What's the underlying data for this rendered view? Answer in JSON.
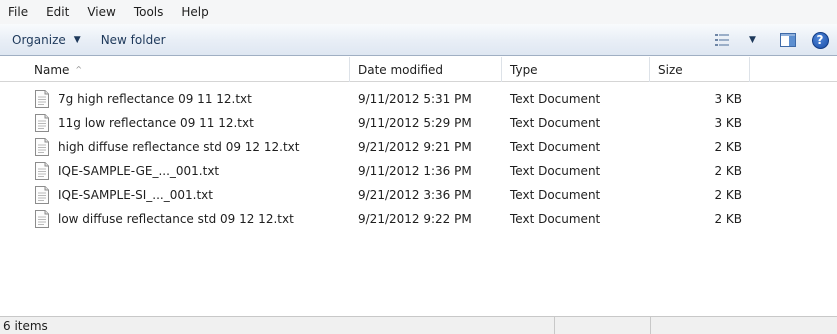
{
  "menu": [
    "File",
    "Edit",
    "View",
    "Tools",
    "Help"
  ],
  "toolbar": {
    "organize_label": "Organize",
    "new_folder_label": "New folder",
    "caret": "▼",
    "help_glyph": "?"
  },
  "columns": {
    "name": "Name",
    "date": "Date modified",
    "type": "Type",
    "size": "Size",
    "sort_glyph": "^"
  },
  "files": [
    {
      "name": "7g high reflectance 09 11 12.txt",
      "date": "9/11/2012 5:31 PM",
      "type": "Text Document",
      "size": "3 KB"
    },
    {
      "name": "11g low reflectance 09 11 12.txt",
      "date": "9/11/2012 5:29 PM",
      "type": "Text Document",
      "size": "3 KB"
    },
    {
      "name": "high diffuse reflectance std 09 12 12.txt",
      "date": "9/21/2012 9:21 PM",
      "type": "Text Document",
      "size": "2 KB"
    },
    {
      "name": "IQE-SAMPLE-GE_..._001.txt",
      "date": "9/11/2012 1:36 PM",
      "type": "Text Document",
      "size": "2 KB"
    },
    {
      "name": "IQE-SAMPLE-SI_..._001.txt",
      "date": "9/21/2012 3:36 PM",
      "type": "Text Document",
      "size": "2 KB"
    },
    {
      "name": "low diffuse reflectance std 09 12 12.txt",
      "date": "9/21/2012 9:22 PM",
      "type": "Text Document",
      "size": "2 KB"
    }
  ],
  "status": {
    "count": "6 items"
  },
  "colors": {
    "toolbar_text": "#1e395b",
    "help_blue": "#1b4fa8"
  }
}
